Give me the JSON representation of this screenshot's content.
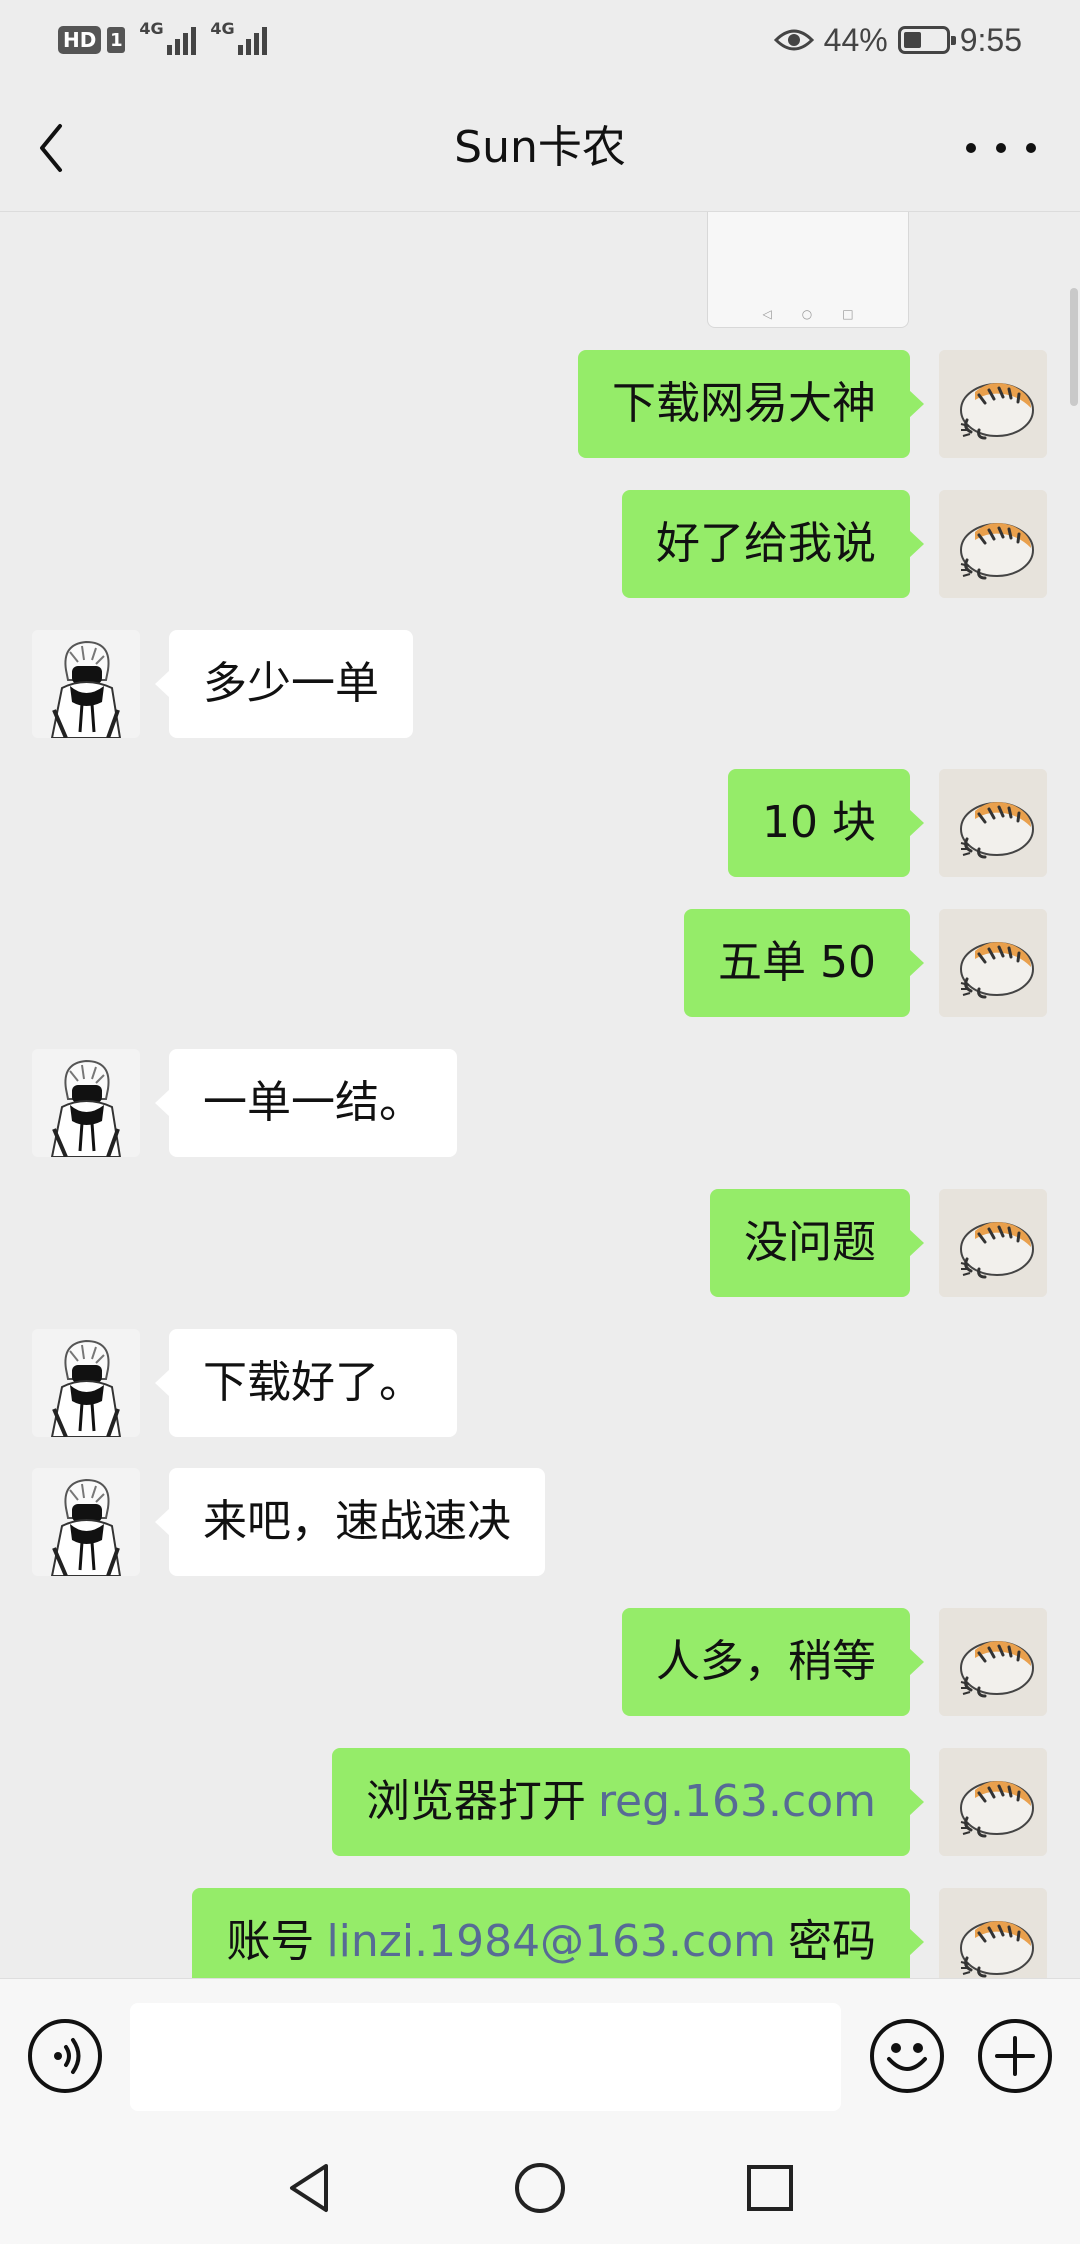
{
  "status_bar": {
    "hd": "HD",
    "sim": "1",
    "network1": "4G",
    "network2": "4G",
    "battery": "44%",
    "battery_level": 0.44,
    "time": "9:55"
  },
  "header": {
    "title": "Sun卡农"
  },
  "colors": {
    "sent_bubble": "#95ec69",
    "received_bubble": "#ffffff",
    "background": "#ededed",
    "link": "#576b95"
  },
  "messages": [
    {
      "side": "right",
      "text": "下载网易大神"
    },
    {
      "side": "right",
      "text": "好了给我说"
    },
    {
      "side": "left",
      "text": "多少一单"
    },
    {
      "side": "right",
      "text": "10 块"
    },
    {
      "side": "right",
      "text": "五单 50"
    },
    {
      "side": "left",
      "text": "一单一结。"
    },
    {
      "side": "right",
      "text": "没问题"
    },
    {
      "side": "left",
      "text": "下载好了。"
    },
    {
      "side": "left",
      "text": "来吧，速战速决"
    },
    {
      "side": "right",
      "text": "人多，稍等"
    },
    {
      "side": "right",
      "text": "浏览器打开",
      "link": "reg.163.com"
    },
    {
      "side": "right",
      "text": "账号",
      "link": "linzi.1984@163.com",
      "suffix": "密码"
    }
  ],
  "input_bar": {
    "placeholder": ""
  },
  "icons": {
    "back": "chevron-left-icon",
    "more": "more-dots-icon",
    "voice": "voice-icon",
    "emoji": "emoji-icon",
    "plus": "plus-icon",
    "nav_back": "triangle-back-icon",
    "nav_home": "circle-home-icon",
    "nav_recent": "square-recent-icon"
  }
}
